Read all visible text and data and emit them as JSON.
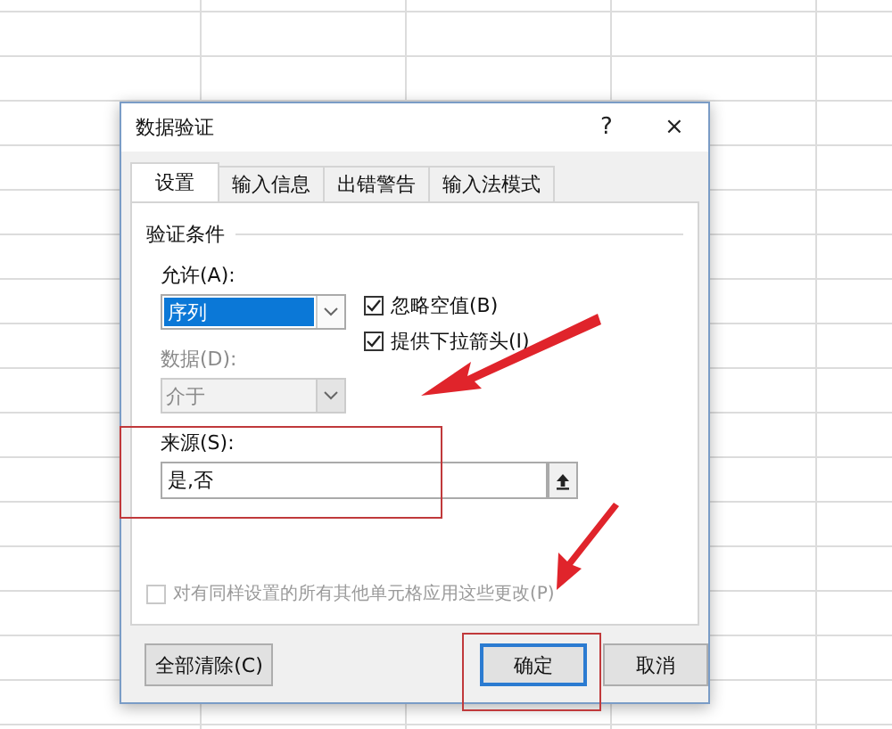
{
  "window": {
    "title": "数据验证",
    "help_button": "?",
    "close_button": "×"
  },
  "tabs": [
    {
      "label": "设置",
      "selected": true
    },
    {
      "label": "输入信息",
      "selected": false
    },
    {
      "label": "出错警告",
      "selected": false
    },
    {
      "label": "输入法模式",
      "selected": false
    }
  ],
  "section_title": "验证条件",
  "allow": {
    "label": "允许(A):",
    "value": "序列",
    "highlighted": true
  },
  "data": {
    "label": "数据(D):",
    "value": "介于",
    "disabled": true
  },
  "checkboxes": [
    {
      "label": "忽略空值(B)",
      "checked": true
    },
    {
      "label": "提供下拉箭头(I)",
      "checked": true
    }
  ],
  "source": {
    "label": "来源(S):",
    "value": "是,否"
  },
  "apply_all": {
    "label": "对有同样设置的所有其他单元格应用这些更改(P)",
    "checked": false,
    "disabled": true
  },
  "buttons": [
    {
      "label": "全部清除(C)",
      "default": false
    },
    {
      "label": "确定",
      "default": true
    },
    {
      "label": "取消",
      "default": false
    }
  ]
}
